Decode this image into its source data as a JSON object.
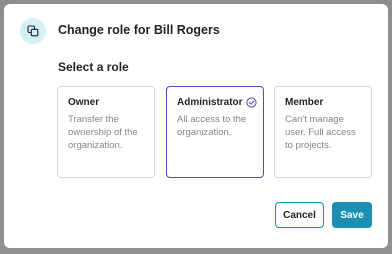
{
  "dialog": {
    "title": "Change role for Bill Rogers",
    "section_label": "Select a role",
    "header_icon": "copy-icon"
  },
  "roles": [
    {
      "name": "Owner",
      "description": "Transfer the ownership of the organization.",
      "selected": false
    },
    {
      "name": "Administrator",
      "description": "All access to the organization.",
      "selected": true
    },
    {
      "name": "Member",
      "description": "Can't manage user. Full access to projects.",
      "selected": false
    }
  ],
  "actions": {
    "cancel_label": "Cancel",
    "save_label": "Save"
  },
  "colors": {
    "accent": "#1d8fb3",
    "selected_border": "#5b45c6",
    "icon_bg": "#d3f0f6"
  }
}
